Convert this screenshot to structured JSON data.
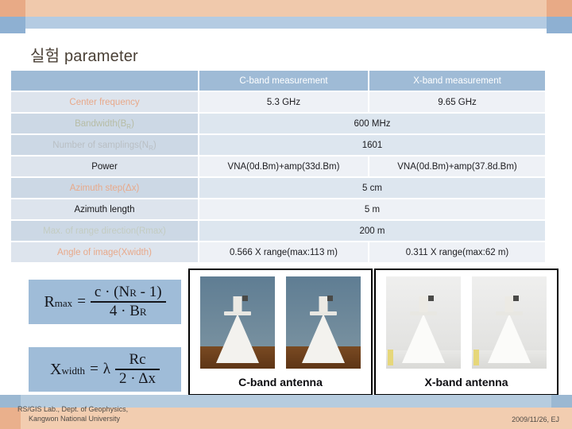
{
  "slide": {
    "title": "실험 parameter",
    "title_color": "#4a4036"
  },
  "table": {
    "headers": {
      "label_blank": "",
      "cband": "C-band measurement",
      "xband": "X-band measurement"
    },
    "rows": [
      {
        "label": "Center frequency",
        "label_color": "#e8a98a",
        "merged": false,
        "cband": "5.3 GHz",
        "xband": "9.65 GHz"
      },
      {
        "label": "Bandwidth(BR)",
        "label_main": "Bandwidth(B",
        "label_sub": "R",
        "label_tail": ")",
        "label_color": "#b7bda6",
        "merged": true,
        "value": "600 MHz"
      },
      {
        "label": "Number of samplings(NR)",
        "label_main": "Number of samplings(N",
        "label_sub": "R",
        "label_tail": ")",
        "label_color": "#b9bfc4",
        "merged": true,
        "value": "1601"
      },
      {
        "label": "Power",
        "label_color": "#17171a",
        "merged": false,
        "cband": "VNA(0d.Bm)+amp(33d.Bm)",
        "xband": "VNA(0d.Bm)+amp(37.8d.Bm)"
      },
      {
        "label": "Azimuth step(Δx)",
        "label_color": "#e8a98a",
        "merged": true,
        "value": "5 cm"
      },
      {
        "label": "Azimuth length",
        "label_color": "#17171a",
        "merged": true,
        "value": "5 m"
      },
      {
        "label": "Max. of range direction(Rmax)",
        "label_color": "#c3ccc2",
        "merged": true,
        "value": "200 m"
      },
      {
        "label": "Angle of image(Xwidth)",
        "label_color": "#e8a98a",
        "merged": false,
        "cband": "0.566 X range(max:113 m)",
        "xband": "0.311 X range(max:62 m)"
      }
    ]
  },
  "formulas": [
    {
      "id": "rmax",
      "lhs_main": "R",
      "lhs_sub": "max",
      "equals": "=",
      "numerator_main": "c · (N",
      "numerator_sub": "R",
      "numerator_tail": " - 1)",
      "denominator_main": "4 · B",
      "denominator_sub": "R",
      "denominator_tail": ""
    },
    {
      "id": "xwidth",
      "lhs_main": "X",
      "lhs_sub": "width",
      "equals": "=",
      "lambda": "λ",
      "numerator_main": "Rc",
      "numerator_sub": "",
      "numerator_tail": "",
      "denominator_main": "2 · Δx",
      "denominator_sub": "",
      "denominator_tail": ""
    }
  ],
  "photos": {
    "cband": {
      "caption": "C-band antenna",
      "count": 2
    },
    "xband": {
      "caption": "X-band antenna",
      "count": 2
    }
  },
  "footer": {
    "org_line1": "RS/GIS Lab., Dept. of Geophysics,",
    "org_line2": "Kangwon National University",
    "date_author": "2009/11/26, EJ"
  },
  "colors": {
    "banner_peach": "#f0c9ac",
    "banner_peach_edge": "#e8aa86",
    "banner_blue": "#b4cbe2",
    "banner_blue_edge": "#8eb0d2",
    "table_header": "#9fbbd6",
    "formula_bg": "#9fbcd8"
  }
}
